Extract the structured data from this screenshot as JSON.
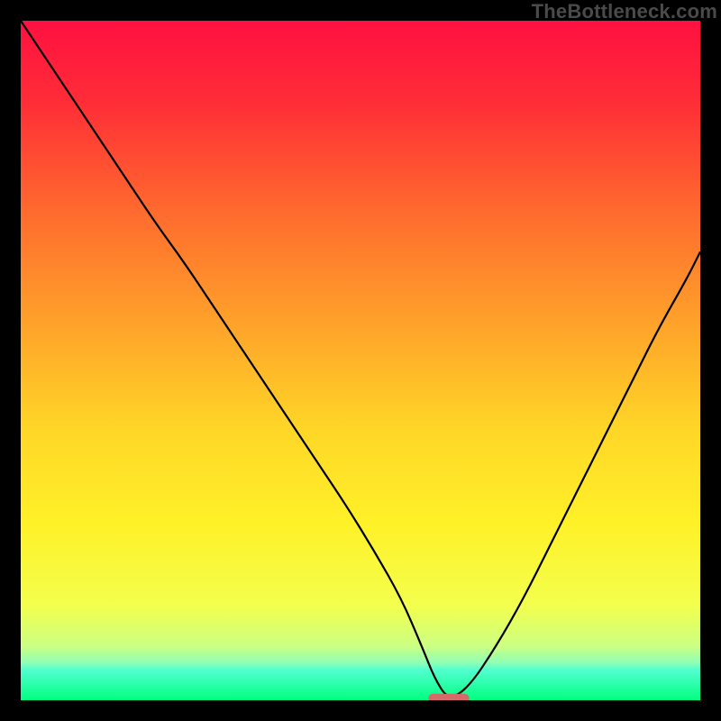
{
  "watermark": "TheBottleneck.com",
  "chart_data": {
    "type": "line",
    "title": "",
    "xlabel": "",
    "ylabel": "",
    "xlim": [
      0,
      100
    ],
    "ylim": [
      0,
      100
    ],
    "grid": false,
    "legend": false,
    "background_gradient": {
      "type": "rainbow-vertical",
      "stops": [
        {
          "pos": 0.0,
          "color": "#ff1040"
        },
        {
          "pos": 0.12,
          "color": "#ff2d37"
        },
        {
          "pos": 0.28,
          "color": "#ff6a2e"
        },
        {
          "pos": 0.44,
          "color": "#ffa02a"
        },
        {
          "pos": 0.6,
          "color": "#ffd627"
        },
        {
          "pos": 0.74,
          "color": "#fff128"
        },
        {
          "pos": 0.86,
          "color": "#f3ff4d"
        },
        {
          "pos": 0.92,
          "color": "#ccff82"
        },
        {
          "pos": 0.945,
          "color": "#8effb6"
        },
        {
          "pos": 0.955,
          "color": "#52ffd0"
        },
        {
          "pos": 1.0,
          "color": "#00ff7f"
        }
      ]
    },
    "series": [
      {
        "name": "bottleneck-curve",
        "color": "#000000",
        "x": [
          0,
          4,
          8,
          12,
          16,
          20,
          24,
          28,
          32,
          36,
          40,
          44,
          48,
          52,
          56,
          59,
          61,
          63,
          66,
          70,
          74,
          78,
          82,
          86,
          90,
          94,
          98,
          100
        ],
        "y": [
          100,
          94,
          88,
          82,
          76,
          70,
          64.5,
          58.5,
          52.5,
          46.5,
          40.5,
          34.5,
          28.5,
          22,
          15,
          8,
          3,
          0,
          2,
          8,
          15,
          23,
          31,
          39,
          47,
          55,
          62,
          66
        ]
      }
    ],
    "marker": {
      "name": "optimal-marker",
      "xlo": 60,
      "xhi": 66,
      "y": 0.3,
      "color": "#d46a6a"
    }
  }
}
